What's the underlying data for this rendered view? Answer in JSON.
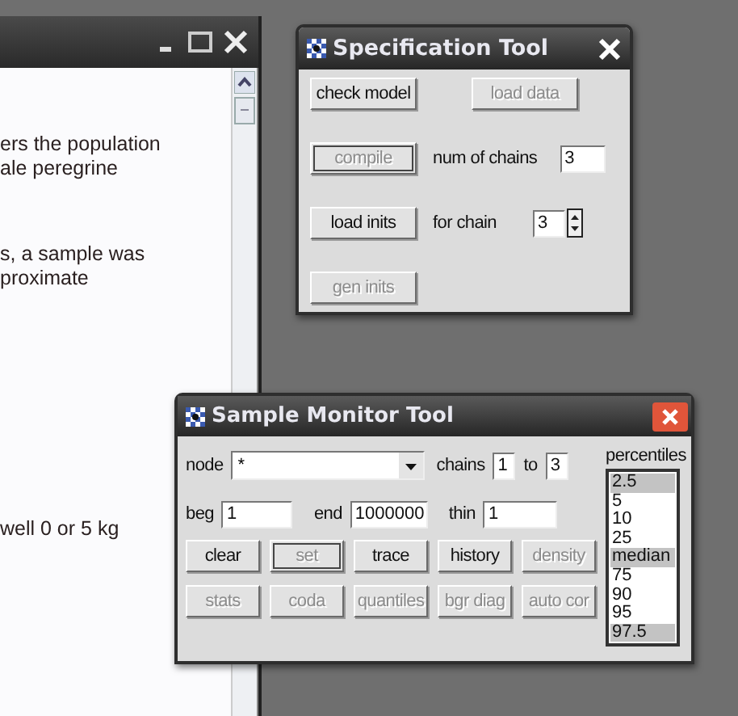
{
  "document_window": {
    "paragraphs": [
      {
        "lines": [
          "ers the population",
          "ale peregrine"
        ]
      },
      {
        "lines": [
          "s, a sample was",
          "proximate"
        ]
      },
      {
        "lines": [
          "well 0 or 5 kg"
        ]
      }
    ]
  },
  "specification_tool": {
    "title": "Specification Tool",
    "rows": [
      [
        {
          "kind": "button",
          "label": "check model",
          "disabled": false,
          "focused": false
        },
        {
          "kind": "button",
          "label": "load data",
          "disabled": true,
          "focused": false
        }
      ],
      [
        {
          "kind": "button",
          "label": "compile",
          "disabled": true,
          "focused": true
        },
        {
          "kind": "field",
          "label": "num of chains",
          "value": "3"
        }
      ],
      [
        {
          "kind": "button",
          "label": "load inits",
          "disabled": false,
          "focused": false
        },
        {
          "kind": "spinner",
          "label": "for chain",
          "value": "3"
        }
      ],
      [
        {
          "kind": "button",
          "label": "gen inits",
          "disabled": true,
          "focused": false
        }
      ]
    ]
  },
  "sample_monitor_tool": {
    "title": "Sample Monitor Tool",
    "node": {
      "label": "node",
      "value": "*"
    },
    "chains": {
      "label": "chains",
      "value": "1"
    },
    "to": {
      "label": "to",
      "value": "3"
    },
    "beg": {
      "label": "beg",
      "value": "1"
    },
    "end": {
      "label": "end",
      "value": "1000000"
    },
    "thin": {
      "label": "thin",
      "value": "1"
    },
    "button_rows": [
      [
        {
          "label": "clear",
          "disabled": false,
          "focused": false
        },
        {
          "label": "set",
          "disabled": true,
          "focused": true
        },
        {
          "label": "trace",
          "disabled": false,
          "focused": false
        },
        {
          "label": "history",
          "disabled": false,
          "focused": false
        },
        {
          "label": "density",
          "disabled": true,
          "focused": false
        }
      ],
      [
        {
          "label": "stats",
          "disabled": true,
          "focused": false
        },
        {
          "label": "coda",
          "disabled": true,
          "focused": false
        },
        {
          "label": "quantiles",
          "disabled": true,
          "focused": false
        },
        {
          "label": "bgr diag",
          "disabled": true,
          "focused": false
        },
        {
          "label": "auto cor",
          "disabled": true,
          "focused": false
        }
      ]
    ],
    "percentiles": {
      "label": "percentiles",
      "items": [
        {
          "label": "2.5",
          "selected": true
        },
        {
          "label": "5",
          "selected": false
        },
        {
          "label": "10",
          "selected": false
        },
        {
          "label": "25",
          "selected": false
        },
        {
          "label": "median",
          "selected": true
        },
        {
          "label": "75",
          "selected": false
        },
        {
          "label": "90",
          "selected": false
        },
        {
          "label": "95",
          "selected": false
        },
        {
          "label": "97.5",
          "selected": true
        }
      ]
    }
  }
}
